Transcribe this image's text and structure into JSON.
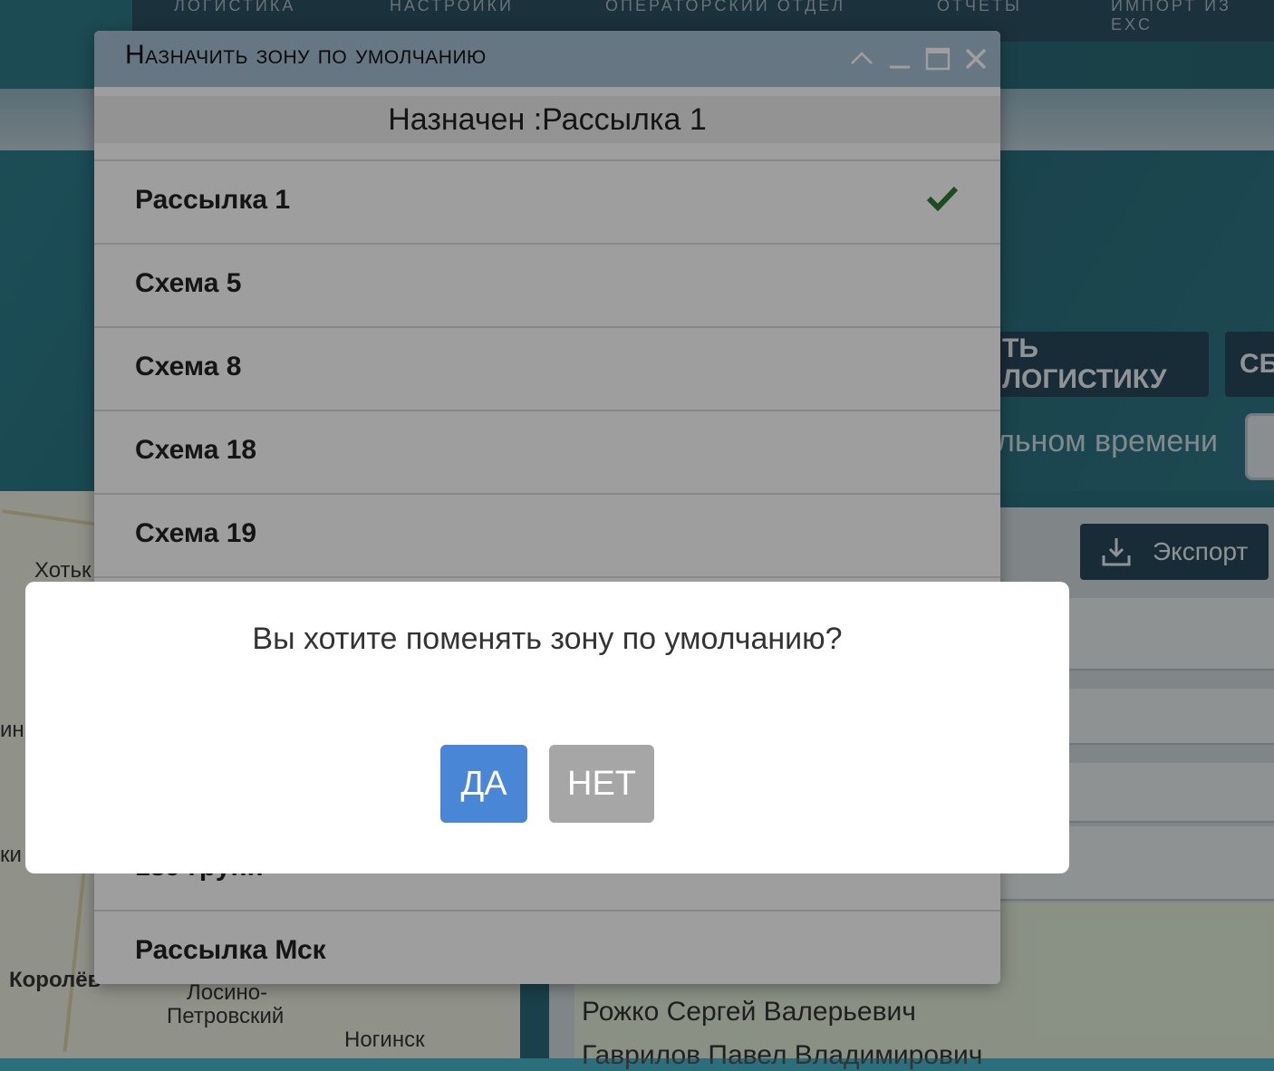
{
  "topnav": {
    "items": [
      "ЛОГИСТИКА",
      "НАСТРОЙКИ",
      "ОПЕРАТОРСКИЙ ОТДЕЛ",
      "ОТЧЕТЫ",
      "ИМПОРТ ИЗ EXC"
    ]
  },
  "background": {
    "logistics_button": "ТЬ ЛОГИСТИКУ",
    "second_button": "СБ",
    "realtime_label": "льном времени",
    "export_button": "Экспорт",
    "map_labels": [
      "Хотьк",
      "ин",
      "ки",
      "Королёв",
      "Лосино-",
      "Петровский",
      "Ногинск"
    ],
    "people": [
      "Рожко Сергей Валерьевич",
      "Гаврилов Павел Владимирович"
    ]
  },
  "window": {
    "title": "Назначить зону по умолчанию",
    "assigned": "Назначен :Рассылка 1",
    "items": [
      {
        "label": "Рассылка 1",
        "selected": true
      },
      {
        "label": "Схема 5",
        "selected": false
      },
      {
        "label": "Схема 8",
        "selected": false
      },
      {
        "label": "Схема 18",
        "selected": false
      },
      {
        "label": "Схема 19",
        "selected": false
      },
      {
        "label": "",
        "selected": false
      },
      {
        "label": "",
        "selected": false
      },
      {
        "label": "",
        "selected": false
      },
      {
        "label": "189 групп",
        "selected": false
      },
      {
        "label": "Рассылка Мск",
        "selected": false
      }
    ]
  },
  "confirm": {
    "question": "Вы хотите поменять зону по умолчанию?",
    "yes_label": "ДА",
    "no_label": "НЕТ"
  },
  "colors": {
    "yes_button": "#4a86d6",
    "no_button": "#a6a6a6",
    "check": "#2e7d32"
  }
}
